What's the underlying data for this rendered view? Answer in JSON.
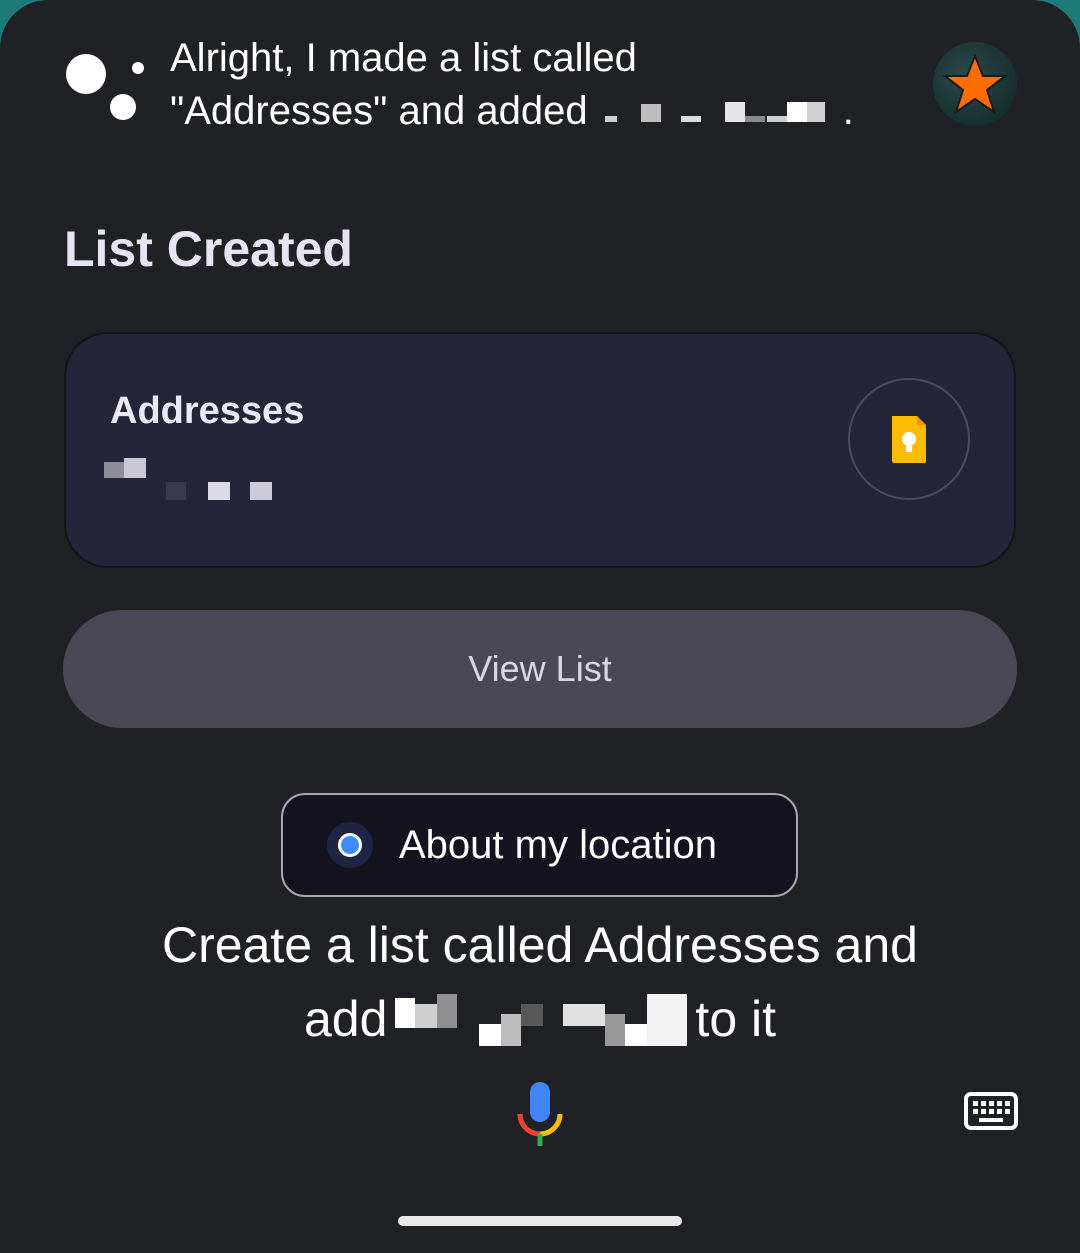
{
  "assistant": {
    "response_line1": "Alright, I made a list called",
    "response_line2_prefix": "\"Addresses\" and added",
    "response_line2_suffix": "."
  },
  "section_title": "List Created",
  "list_card": {
    "name": "Addresses",
    "app_icon": "google-keep-icon"
  },
  "view_button": {
    "label": "View List"
  },
  "suggestion_chip": {
    "label": "About my location"
  },
  "query": {
    "line1": "Create a list called Addresses and",
    "line2_prefix": "add",
    "line2_suffix": "to it"
  },
  "colors": {
    "keep_yellow": "#fbbc04",
    "avatar_star": "#ff6d00",
    "chip_dot": "#3f8cff"
  }
}
